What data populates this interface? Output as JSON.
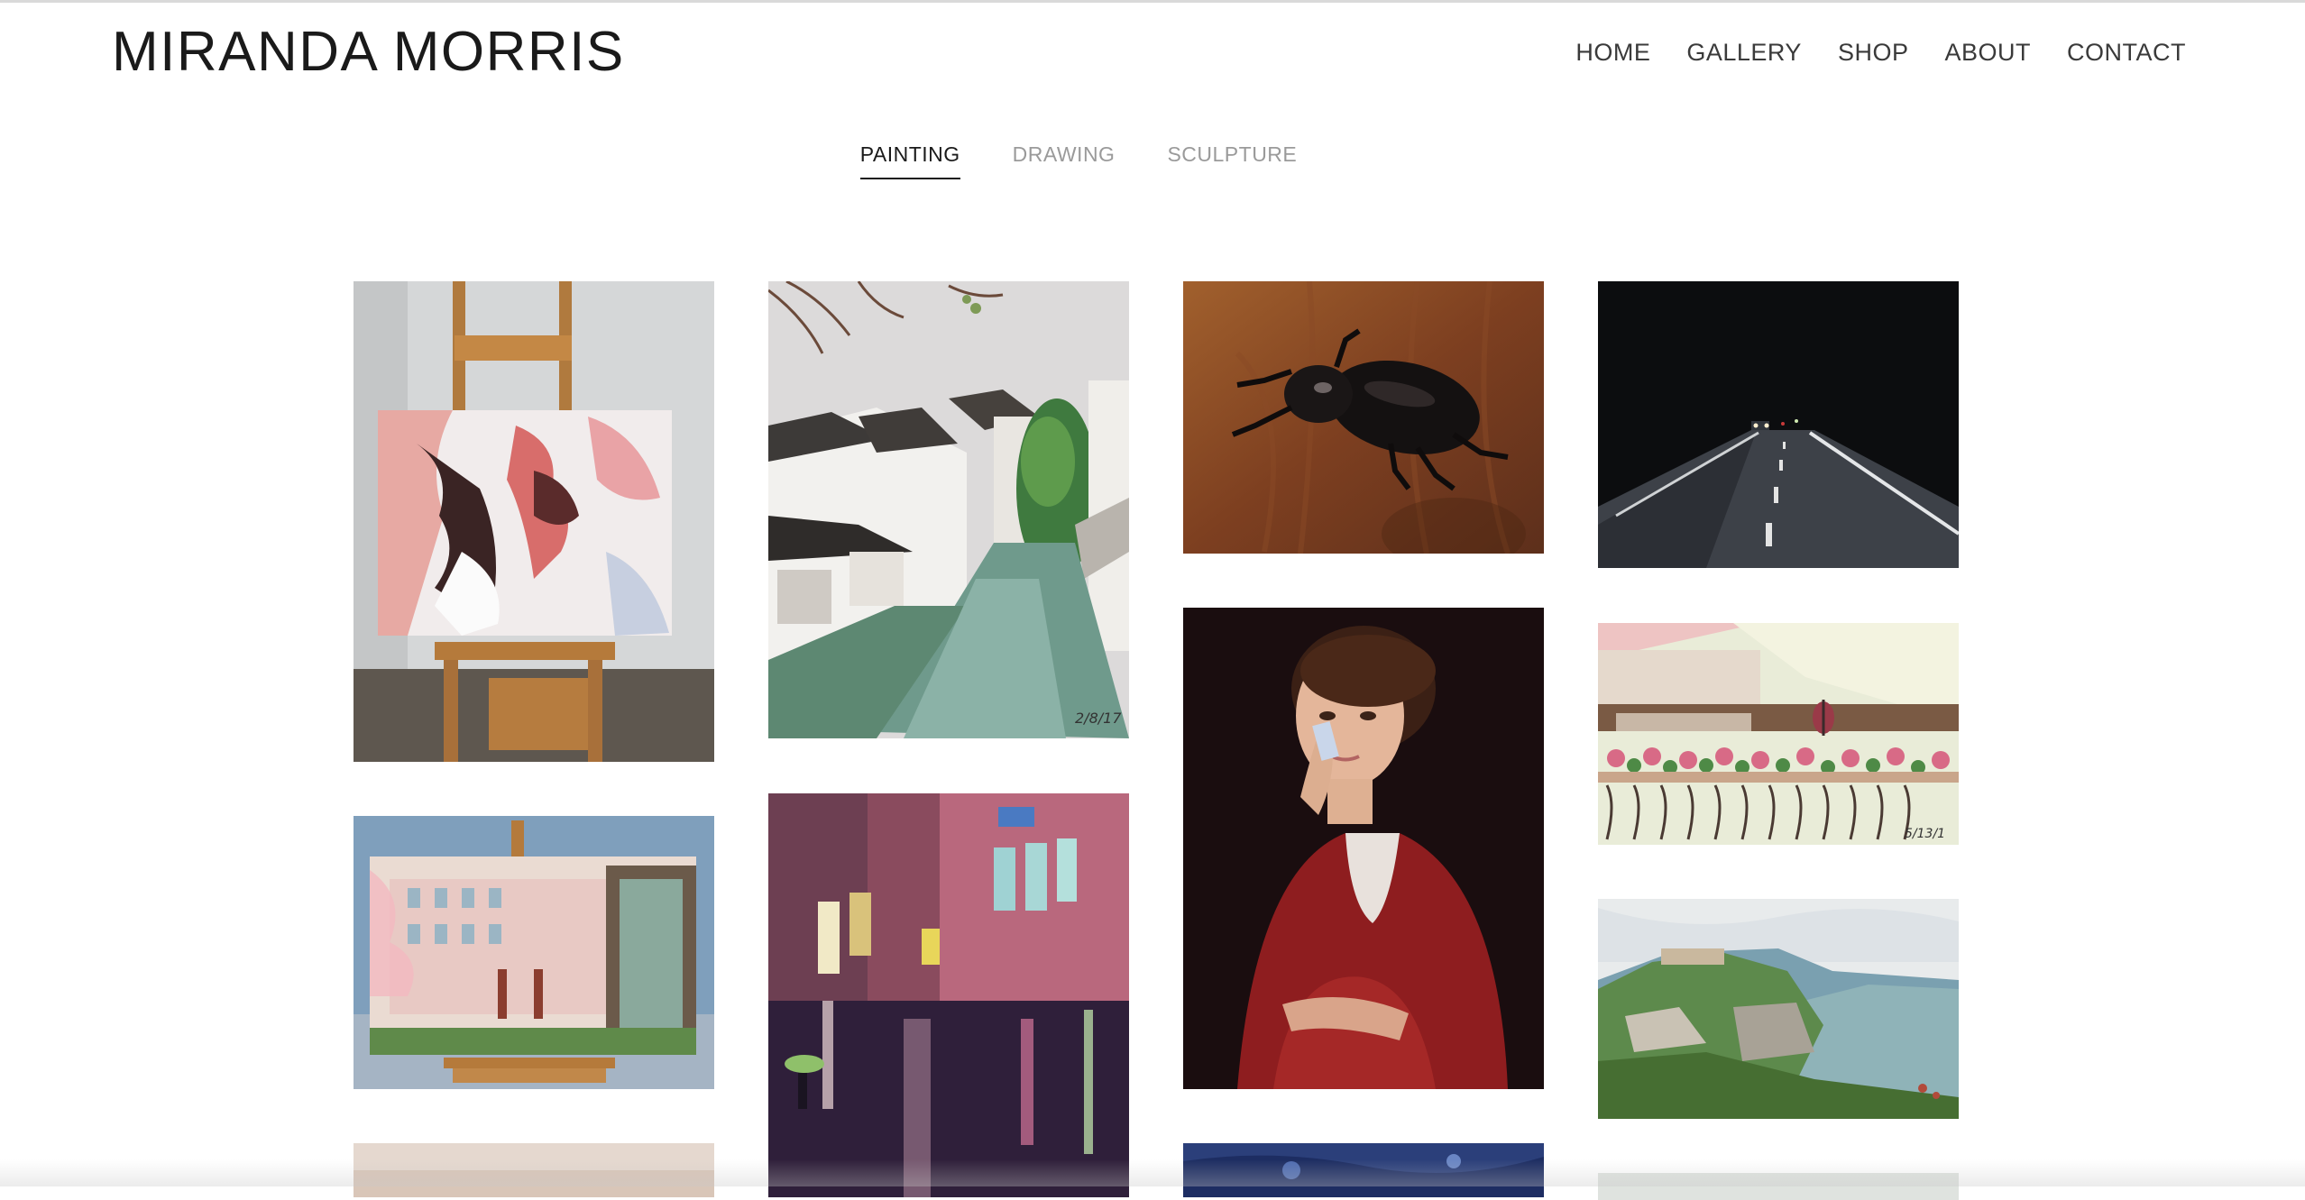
{
  "site": {
    "title": "MIRANDA MORRIS"
  },
  "nav": {
    "items": [
      {
        "label": "HOME"
      },
      {
        "label": "GALLERY"
      },
      {
        "label": "SHOP"
      },
      {
        "label": "ABOUT"
      },
      {
        "label": "CONTACT"
      }
    ]
  },
  "gallery_tabs": {
    "active": "PAINTING",
    "items": [
      {
        "label": "PAINTING"
      },
      {
        "label": "DRAWING"
      },
      {
        "label": "SCULPTURE"
      }
    ]
  },
  "paintings": [
    {
      "subject": "faces-on-easel",
      "signature": ""
    },
    {
      "subject": "canal-village",
      "signature": "2/8/17"
    },
    {
      "subject": "beetle",
      "signature": ""
    },
    {
      "subject": "night-road",
      "signature": ""
    },
    {
      "subject": "blossom-building-on-easel",
      "signature": ""
    },
    {
      "subject": "rainy-city-street",
      "signature": ""
    },
    {
      "subject": "girl-on-phone-portrait",
      "signature": ""
    },
    {
      "subject": "flower-balcony",
      "signature": "5/13/1"
    },
    {
      "subject": "hilltop-landscape",
      "signature": ""
    },
    {
      "subject": "partial-bottom-left",
      "signature": ""
    },
    {
      "subject": "partial-blue",
      "signature": ""
    },
    {
      "subject": "partial-bottom-right",
      "signature": ""
    }
  ]
}
